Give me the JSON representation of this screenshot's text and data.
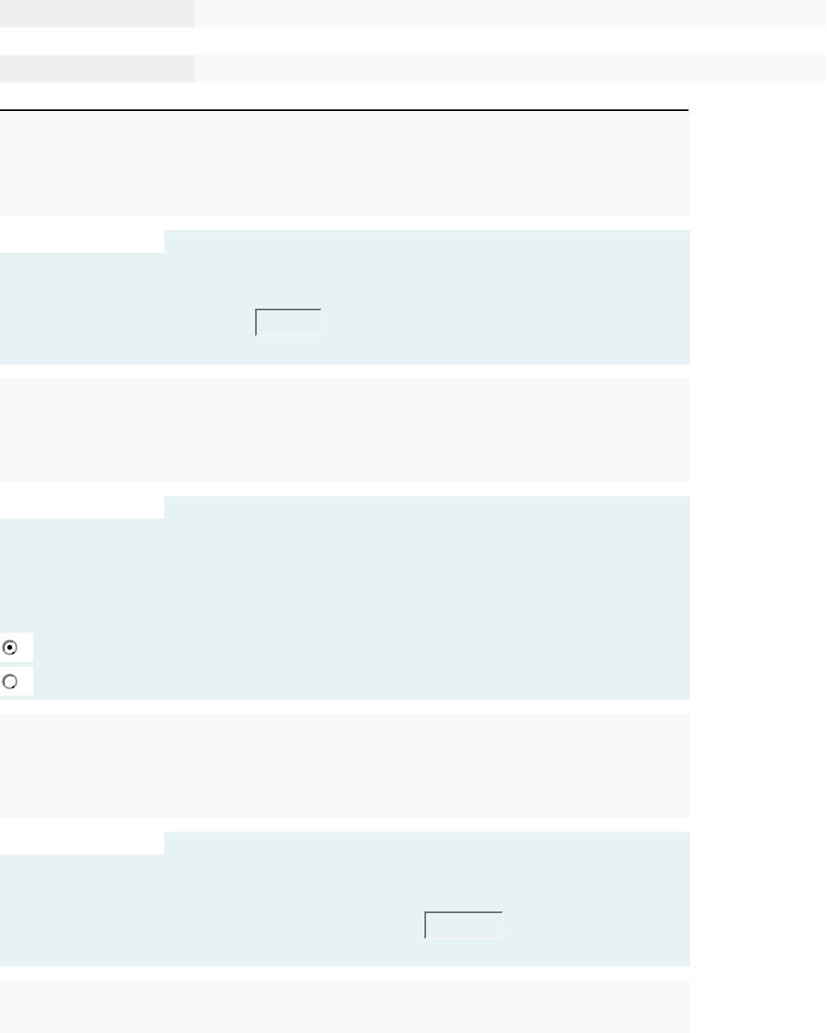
{
  "questions": [
    {
      "kind": "input"
    },
    {
      "kind": "choice",
      "options": [
        {
          "selected": true
        },
        {
          "selected": false
        }
      ]
    },
    {
      "kind": "input"
    }
  ]
}
